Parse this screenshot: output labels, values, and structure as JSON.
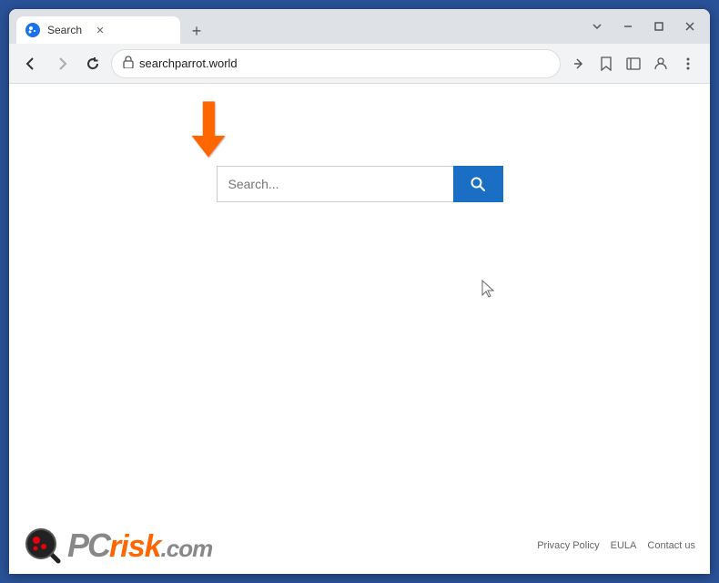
{
  "browser": {
    "tab": {
      "title": "Search",
      "favicon_label": "S"
    },
    "new_tab_btn": "+",
    "window_controls": {
      "chevron": "˅",
      "minimize": "–",
      "maximize": "□",
      "close": "✕"
    },
    "nav": {
      "back": "←",
      "forward": "→",
      "reload": "↻",
      "address": "searchparrot.world",
      "lock_icon": "🔒"
    },
    "nav_actions": {
      "share": "⬆",
      "star": "☆",
      "sidebar": "▣",
      "profile": "👤",
      "menu": "⋮"
    }
  },
  "page": {
    "search_placeholder": "Search...",
    "search_btn_label": "🔍"
  },
  "footer": {
    "logo_pc": "PC",
    "logo_risk": "risk",
    "logo_com": ".com",
    "links": [
      {
        "label": "Privacy Policy",
        "key": "privacy"
      },
      {
        "label": "EULA",
        "key": "eula"
      },
      {
        "label": "Contact us",
        "key": "contact"
      }
    ]
  }
}
